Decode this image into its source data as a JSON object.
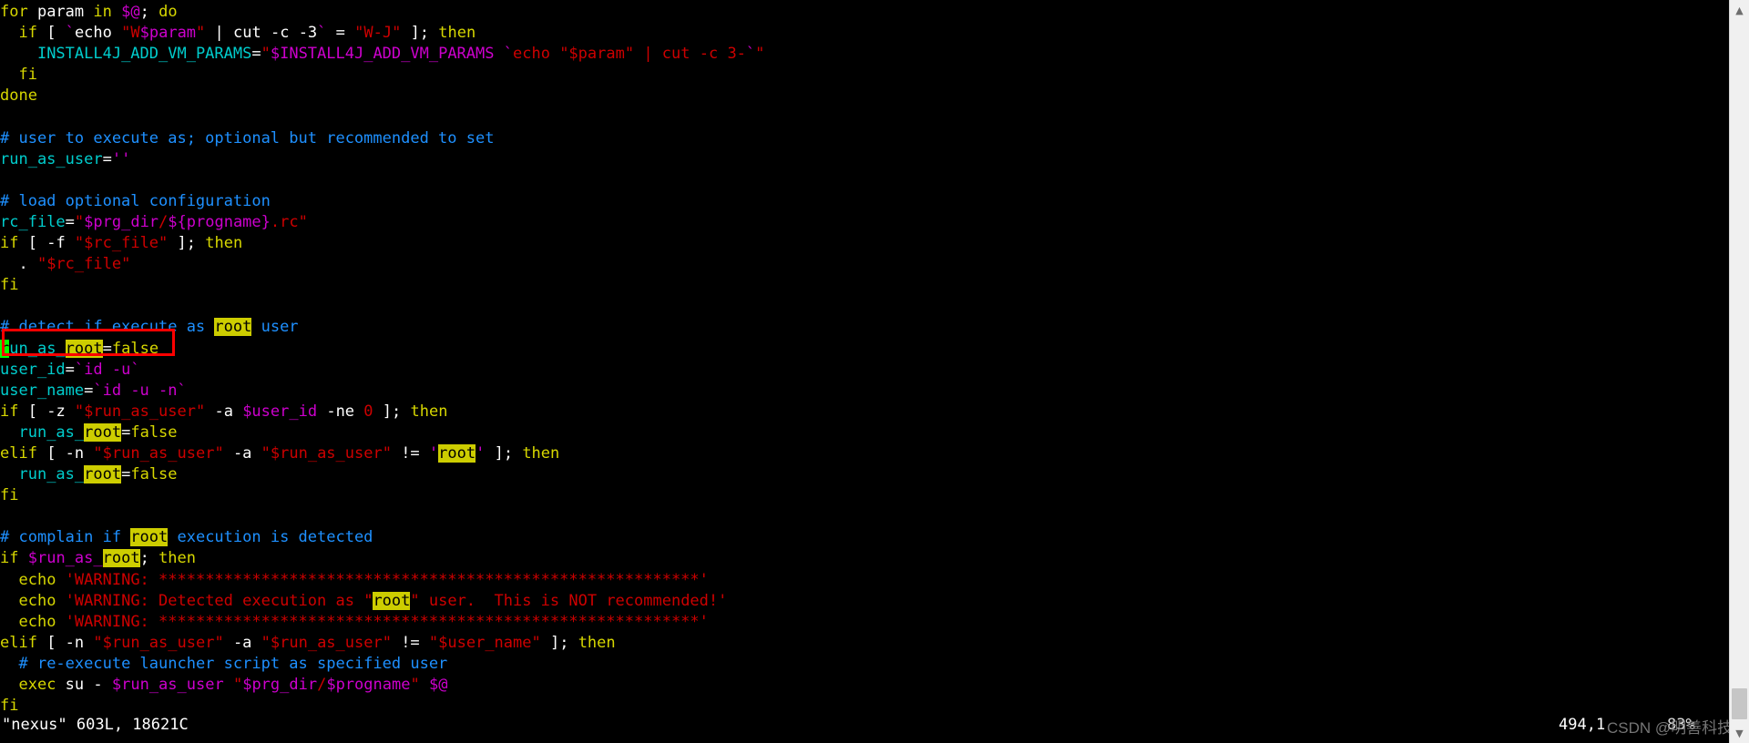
{
  "window": {
    "title": "nexus",
    "app": "vim"
  },
  "editor": {
    "lines": [
      {
        "id": "l1",
        "segments": [
          {
            "t": "for",
            "c": "c-keyword"
          },
          {
            "t": " param ",
            "c": "c-normal"
          },
          {
            "t": "in",
            "c": "c-keyword"
          },
          {
            "t": " ",
            "c": "c-normal"
          },
          {
            "t": "$@",
            "c": "c-var"
          },
          {
            "t": "; ",
            "c": "c-normal"
          },
          {
            "t": "do",
            "c": "c-keyword"
          }
        ]
      },
      {
        "id": "l2",
        "segments": [
          {
            "t": "  ",
            "c": "c-normal"
          },
          {
            "t": "if",
            "c": "c-keyword"
          },
          {
            "t": " [ ",
            "c": "c-normal"
          },
          {
            "t": "`",
            "c": "c-var"
          },
          {
            "t": "echo ",
            "c": "c-normal"
          },
          {
            "t": "\"",
            "c": "c-string"
          },
          {
            "t": "W",
            "c": "c-string"
          },
          {
            "t": "$param",
            "c": "c-var"
          },
          {
            "t": "\"",
            "c": "c-string"
          },
          {
            "t": " | ",
            "c": "c-normal"
          },
          {
            "t": "cut ",
            "c": "c-normal"
          },
          {
            "t": "-c ",
            "c": "c-normal"
          },
          {
            "t": "-3",
            "c": "c-normal"
          },
          {
            "t": "`",
            "c": "c-var"
          },
          {
            "t": " = ",
            "c": "c-normal"
          },
          {
            "t": "\"W-J\"",
            "c": "c-string"
          },
          {
            "t": " ]; ",
            "c": "c-normal"
          },
          {
            "t": "then",
            "c": "c-keyword"
          }
        ]
      },
      {
        "id": "l3",
        "segments": [
          {
            "t": "    ",
            "c": "c-normal"
          },
          {
            "t": "INSTALL4J_ADD_VM_PARAMS",
            "c": "c-ident"
          },
          {
            "t": "=",
            "c": "c-op"
          },
          {
            "t": "\"",
            "c": "c-string"
          },
          {
            "t": "$INSTALL4J_ADD_VM_PARAMS",
            "c": "c-var"
          },
          {
            "t": " ",
            "c": "c-string"
          },
          {
            "t": "`",
            "c": "c-var"
          },
          {
            "t": "echo ",
            "c": "c-string"
          },
          {
            "t": "\"$param\"",
            "c": "c-string"
          },
          {
            "t": " | ",
            "c": "c-string"
          },
          {
            "t": "cut -c 3-",
            "c": "c-string"
          },
          {
            "t": "`",
            "c": "c-var"
          },
          {
            "t": "\"",
            "c": "c-string"
          }
        ]
      },
      {
        "id": "l4",
        "segments": [
          {
            "t": "  ",
            "c": "c-normal"
          },
          {
            "t": "fi",
            "c": "c-keyword"
          }
        ]
      },
      {
        "id": "l5",
        "segments": [
          {
            "t": "done",
            "c": "c-keyword"
          }
        ]
      },
      {
        "id": "l6",
        "segments": []
      },
      {
        "id": "l7",
        "segments": [
          {
            "t": "# user to execute as; optional but recommended to set",
            "c": "c-comment"
          }
        ]
      },
      {
        "id": "l8",
        "segments": [
          {
            "t": "run_as_user",
            "c": "c-ident"
          },
          {
            "t": "=",
            "c": "c-op"
          },
          {
            "t": "''",
            "c": "c-var"
          }
        ]
      },
      {
        "id": "l9",
        "segments": []
      },
      {
        "id": "l10",
        "segments": [
          {
            "t": "# load optional configuration",
            "c": "c-comment"
          }
        ]
      },
      {
        "id": "l11",
        "segments": [
          {
            "t": "rc_file",
            "c": "c-ident"
          },
          {
            "t": "=",
            "c": "c-op"
          },
          {
            "t": "\"",
            "c": "c-string"
          },
          {
            "t": "$prg_dir",
            "c": "c-var"
          },
          {
            "t": "/",
            "c": "c-string"
          },
          {
            "t": "${progname}",
            "c": "c-var"
          },
          {
            "t": ".rc",
            "c": "c-string"
          },
          {
            "t": "\"",
            "c": "c-string"
          }
        ]
      },
      {
        "id": "l12",
        "segments": [
          {
            "t": "if",
            "c": "c-keyword"
          },
          {
            "t": " [ ",
            "c": "c-normal"
          },
          {
            "t": "-f ",
            "c": "c-normal"
          },
          {
            "t": "\"$rc_file\"",
            "c": "c-string"
          },
          {
            "t": " ]; ",
            "c": "c-normal"
          },
          {
            "t": "then",
            "c": "c-keyword"
          }
        ]
      },
      {
        "id": "l13",
        "segments": [
          {
            "t": "  . ",
            "c": "c-normal"
          },
          {
            "t": "\"$rc_file\"",
            "c": "c-string"
          }
        ]
      },
      {
        "id": "l14",
        "segments": [
          {
            "t": "fi",
            "c": "c-keyword"
          }
        ]
      },
      {
        "id": "l15",
        "segments": []
      },
      {
        "id": "l16",
        "segments": [
          {
            "t": "# detect if execute as ",
            "c": "c-comment"
          },
          {
            "t": "root",
            "c": "hl"
          },
          {
            "t": " user",
            "c": "c-comment"
          }
        ]
      },
      {
        "id": "l17",
        "segments": [
          {
            "t": "r",
            "c": "cursor"
          },
          {
            "t": "un_as_",
            "c": "c-ident"
          },
          {
            "t": "root",
            "c": "hl"
          },
          {
            "t": "=",
            "c": "c-op"
          },
          {
            "t": "false",
            "c": "c-const"
          }
        ]
      },
      {
        "id": "l18",
        "segments": [
          {
            "t": "user_id",
            "c": "c-ident"
          },
          {
            "t": "=",
            "c": "c-op"
          },
          {
            "t": "`id -u`",
            "c": "c-var"
          }
        ]
      },
      {
        "id": "l19",
        "segments": [
          {
            "t": "user_name",
            "c": "c-ident"
          },
          {
            "t": "=",
            "c": "c-op"
          },
          {
            "t": "`id -u -n`",
            "c": "c-var"
          }
        ]
      },
      {
        "id": "l20",
        "segments": [
          {
            "t": "if",
            "c": "c-keyword"
          },
          {
            "t": " [ ",
            "c": "c-normal"
          },
          {
            "t": "-z ",
            "c": "c-normal"
          },
          {
            "t": "\"$run_as_user\"",
            "c": "c-string"
          },
          {
            "t": " ",
            "c": "c-normal"
          },
          {
            "t": "-a ",
            "c": "c-normal"
          },
          {
            "t": "$user_id",
            "c": "c-var"
          },
          {
            "t": " ",
            "c": "c-normal"
          },
          {
            "t": "-ne ",
            "c": "c-normal"
          },
          {
            "t": "0",
            "c": "c-num"
          },
          {
            "t": " ]; ",
            "c": "c-normal"
          },
          {
            "t": "then",
            "c": "c-keyword"
          }
        ]
      },
      {
        "id": "l21",
        "segments": [
          {
            "t": "  ",
            "c": "c-normal"
          },
          {
            "t": "run_as_",
            "c": "c-ident"
          },
          {
            "t": "root",
            "c": "hl"
          },
          {
            "t": "=",
            "c": "c-op"
          },
          {
            "t": "false",
            "c": "c-const"
          }
        ]
      },
      {
        "id": "l22",
        "segments": [
          {
            "t": "elif",
            "c": "c-keyword"
          },
          {
            "t": " [ ",
            "c": "c-normal"
          },
          {
            "t": "-n ",
            "c": "c-normal"
          },
          {
            "t": "\"$run_as_user\"",
            "c": "c-string"
          },
          {
            "t": " ",
            "c": "c-normal"
          },
          {
            "t": "-a ",
            "c": "c-normal"
          },
          {
            "t": "\"$run_as_user\"",
            "c": "c-string"
          },
          {
            "t": " != ",
            "c": "c-normal"
          },
          {
            "t": "'",
            "c": "c-var"
          },
          {
            "t": "root",
            "c": "hl"
          },
          {
            "t": "'",
            "c": "c-var"
          },
          {
            "t": " ]; ",
            "c": "c-normal"
          },
          {
            "t": "then",
            "c": "c-keyword"
          }
        ]
      },
      {
        "id": "l23",
        "segments": [
          {
            "t": "  ",
            "c": "c-normal"
          },
          {
            "t": "run_as_",
            "c": "c-ident"
          },
          {
            "t": "root",
            "c": "hl"
          },
          {
            "t": "=",
            "c": "c-op"
          },
          {
            "t": "false",
            "c": "c-const"
          }
        ]
      },
      {
        "id": "l24",
        "segments": [
          {
            "t": "fi",
            "c": "c-keyword"
          }
        ]
      },
      {
        "id": "l25",
        "segments": []
      },
      {
        "id": "l26",
        "segments": [
          {
            "t": "# complain if ",
            "c": "c-comment"
          },
          {
            "t": "root",
            "c": "hl"
          },
          {
            "t": " execution is detected",
            "c": "c-comment"
          }
        ]
      },
      {
        "id": "l27",
        "segments": [
          {
            "t": "if",
            "c": "c-keyword"
          },
          {
            "t": " ",
            "c": "c-normal"
          },
          {
            "t": "$run_as_",
            "c": "c-var"
          },
          {
            "t": "root",
            "c": "hl"
          },
          {
            "t": "; ",
            "c": "c-normal"
          },
          {
            "t": "then",
            "c": "c-keyword"
          }
        ]
      },
      {
        "id": "l28",
        "segments": [
          {
            "t": "  ",
            "c": "c-normal"
          },
          {
            "t": "echo ",
            "c": "c-keyword"
          },
          {
            "t": "'WARNING: **********************************************************'",
            "c": "c-string"
          }
        ]
      },
      {
        "id": "l29",
        "segments": [
          {
            "t": "  ",
            "c": "c-normal"
          },
          {
            "t": "echo ",
            "c": "c-keyword"
          },
          {
            "t": "'WARNING: Detected execution as \"",
            "c": "c-string"
          },
          {
            "t": "root",
            "c": "hl"
          },
          {
            "t": "\" user.  This is NOT recommended!'",
            "c": "c-string"
          }
        ]
      },
      {
        "id": "l30",
        "segments": [
          {
            "t": "  ",
            "c": "c-normal"
          },
          {
            "t": "echo ",
            "c": "c-keyword"
          },
          {
            "t": "'WARNING: **********************************************************'",
            "c": "c-string"
          }
        ]
      },
      {
        "id": "l31",
        "segments": [
          {
            "t": "elif",
            "c": "c-keyword"
          },
          {
            "t": " [ ",
            "c": "c-normal"
          },
          {
            "t": "-n ",
            "c": "c-normal"
          },
          {
            "t": "\"$run_as_user\"",
            "c": "c-string"
          },
          {
            "t": " ",
            "c": "c-normal"
          },
          {
            "t": "-a ",
            "c": "c-normal"
          },
          {
            "t": "\"$run_as_user\"",
            "c": "c-string"
          },
          {
            "t": " != ",
            "c": "c-normal"
          },
          {
            "t": "\"$user_name\"",
            "c": "c-string"
          },
          {
            "t": " ]; ",
            "c": "c-normal"
          },
          {
            "t": "then",
            "c": "c-keyword"
          }
        ]
      },
      {
        "id": "l32",
        "segments": [
          {
            "t": "  ",
            "c": "c-normal"
          },
          {
            "t": "# re-execute launcher script as specified user",
            "c": "c-comment"
          }
        ]
      },
      {
        "id": "l33",
        "segments": [
          {
            "t": "  ",
            "c": "c-normal"
          },
          {
            "t": "exec ",
            "c": "c-keyword"
          },
          {
            "t": "su",
            "c": "c-normal"
          },
          {
            "t": " - ",
            "c": "c-normal"
          },
          {
            "t": "$run_as_user",
            "c": "c-var"
          },
          {
            "t": " ",
            "c": "c-normal"
          },
          {
            "t": "\"",
            "c": "c-string"
          },
          {
            "t": "$prg_dir",
            "c": "c-var"
          },
          {
            "t": "/",
            "c": "c-string"
          },
          {
            "t": "$progname",
            "c": "c-var"
          },
          {
            "t": "\"",
            "c": "c-string"
          },
          {
            "t": " ",
            "c": "c-normal"
          },
          {
            "t": "$@",
            "c": "c-var"
          }
        ]
      },
      {
        "id": "l34",
        "segments": [
          {
            "t": "fi",
            "c": "c-keyword"
          }
        ]
      }
    ]
  },
  "status": {
    "file_info": "\"nexus\" 603L, 18621C",
    "cursor_position": "494,1",
    "percent": "83%"
  },
  "annotation": {
    "box_color": "#ff0000",
    "target_text": "run_as_root=false"
  },
  "watermark": {
    "text": "CSDN @明善科技"
  },
  "scrollbar": {
    "up_arrow": "chevron-up-icon",
    "down_arrow": "chevron-down-icon"
  },
  "colors": {
    "background": "#000000",
    "search_highlight_bg": "#cdcd00",
    "cursor_bg": "#00ff00",
    "comment": "#1e90ff",
    "keyword": "#d7d700",
    "identifier": "#00cdcd",
    "string": "#cd0000",
    "variable": "#cd00cd",
    "annotation": "#ff0000"
  }
}
